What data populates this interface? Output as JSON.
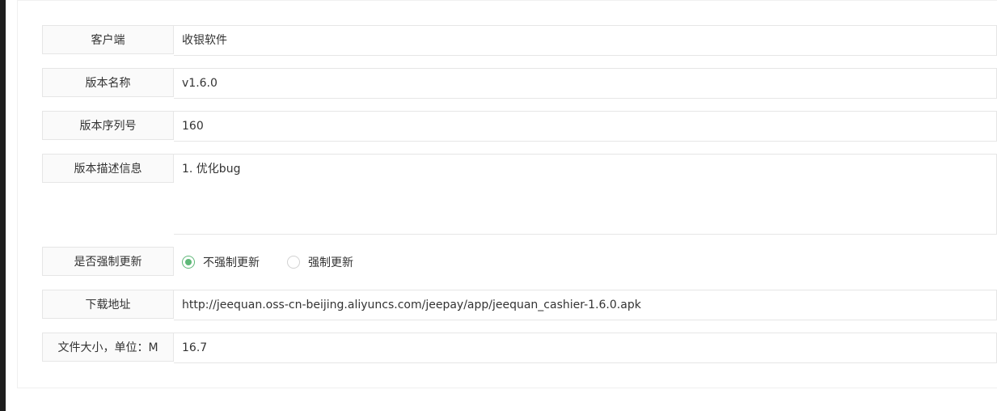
{
  "form": {
    "client_label": "客户端",
    "client_value": "收银软件",
    "version_name_label": "版本名称",
    "version_name_value": "v1.6.0",
    "version_code_label": "版本序列号",
    "version_code_value": "160",
    "description_label": "版本描述信息",
    "description_value": "1. 优化bug",
    "force_update_label": "是否强制更新",
    "force_options": [
      {
        "label": "不强制更新",
        "selected": true
      },
      {
        "label": "强制更新",
        "selected": false
      }
    ],
    "download_label": "下载地址",
    "download_value": "http://jeequan.oss-cn-beijing.aliyuncs.com/jeepay/app/jeequan_cashier-1.6.0.apk",
    "file_size_label": "文件大小，单位：M",
    "file_size_value": "16.7"
  },
  "colors": {
    "accent": "#5fb878",
    "label_bg": "#fafafa",
    "border": "#e6e6e6"
  }
}
